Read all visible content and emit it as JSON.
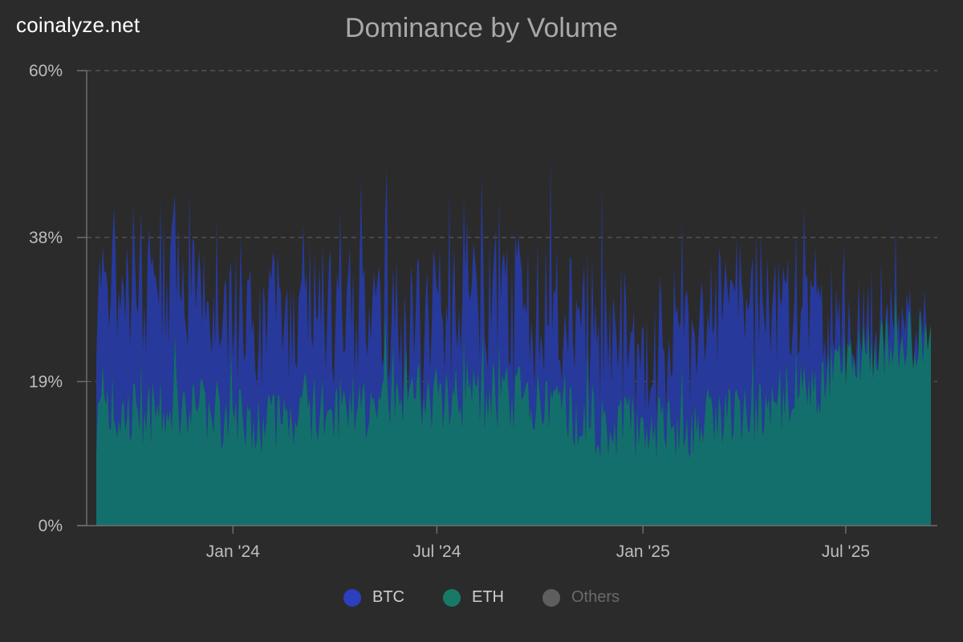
{
  "watermark": "coinalyze.net",
  "chart_data": {
    "type": "area",
    "stacked": true,
    "title": "Dominance by Volume",
    "xlabel": "",
    "ylabel": "",
    "x_range": [
      "2023-09-01",
      "2025-09-15"
    ],
    "ylim": [
      0,
      60
    ],
    "y_ticks": [
      {
        "value": 0,
        "label": "0%"
      },
      {
        "value": 19,
        "label": "19%"
      },
      {
        "value": 38,
        "label": "38%"
      },
      {
        "value": 60,
        "label": "60%"
      }
    ],
    "x_ticks": [
      {
        "date": "2024-01-01",
        "label": "Jan '24"
      },
      {
        "date": "2024-07-01",
        "label": "Jul '24"
      },
      {
        "date": "2025-01-01",
        "label": "Jan '25"
      },
      {
        "date": "2025-07-01",
        "label": "Jul '25"
      }
    ],
    "grid": "horizontal dashed",
    "legend_position": "bottom-center",
    "series": [
      {
        "name": "ETH",
        "color": "#136f6b",
        "x": [
          "2023-09-01",
          "2023-10-01",
          "2023-11-01",
          "2023-12-01",
          "2024-01-01",
          "2024-02-01",
          "2024-03-01",
          "2024-04-01",
          "2024-05-01",
          "2024-06-01",
          "2024-07-01",
          "2024-08-01",
          "2024-09-01",
          "2024-10-01",
          "2024-11-01",
          "2024-12-01",
          "2025-01-01",
          "2025-02-01",
          "2025-03-01",
          "2025-04-01",
          "2025-05-01",
          "2025-06-01",
          "2025-07-01",
          "2025-08-01",
          "2025-09-01",
          "2025-09-15"
        ],
        "values": [
          14,
          15,
          15,
          15,
          14,
          14,
          15,
          16,
          16,
          18,
          17,
          17,
          17,
          16,
          14,
          13,
          13,
          13,
          14,
          15,
          17,
          18,
          22,
          24,
          24,
          25
        ]
      },
      {
        "name": "BTC",
        "color": "#27399b",
        "x": [
          "2023-09-01",
          "2023-10-01",
          "2023-11-01",
          "2023-12-01",
          "2024-01-01",
          "2024-02-01",
          "2024-03-01",
          "2024-04-01",
          "2024-05-01",
          "2024-06-01",
          "2024-07-01",
          "2024-08-01",
          "2024-09-01",
          "2024-10-01",
          "2024-11-01",
          "2024-12-01",
          "2025-01-01",
          "2025-02-01",
          "2025-03-01",
          "2025-04-01",
          "2025-05-01",
          "2025-06-01",
          "2025-07-01",
          "2025-08-01",
          "2025-09-01",
          "2025-09-15"
        ],
        "values": [
          16,
          17,
          18,
          14,
          13,
          13,
          14,
          13,
          12,
          8,
          11,
          13,
          12,
          11,
          12,
          12,
          10,
          11,
          12,
          14,
          12,
          10,
          4,
          2,
          0,
          0
        ]
      },
      {
        "name": "Others",
        "color": "#5e5e5e",
        "hidden": true,
        "x": [],
        "values": []
      }
    ]
  },
  "legend": [
    {
      "label": "BTC",
      "color": "#2b3fbf",
      "muted": false
    },
    {
      "label": "ETH",
      "color": "#177a67",
      "muted": false
    },
    {
      "label": "Others",
      "color": "#5e5e5e",
      "muted": true
    }
  ]
}
